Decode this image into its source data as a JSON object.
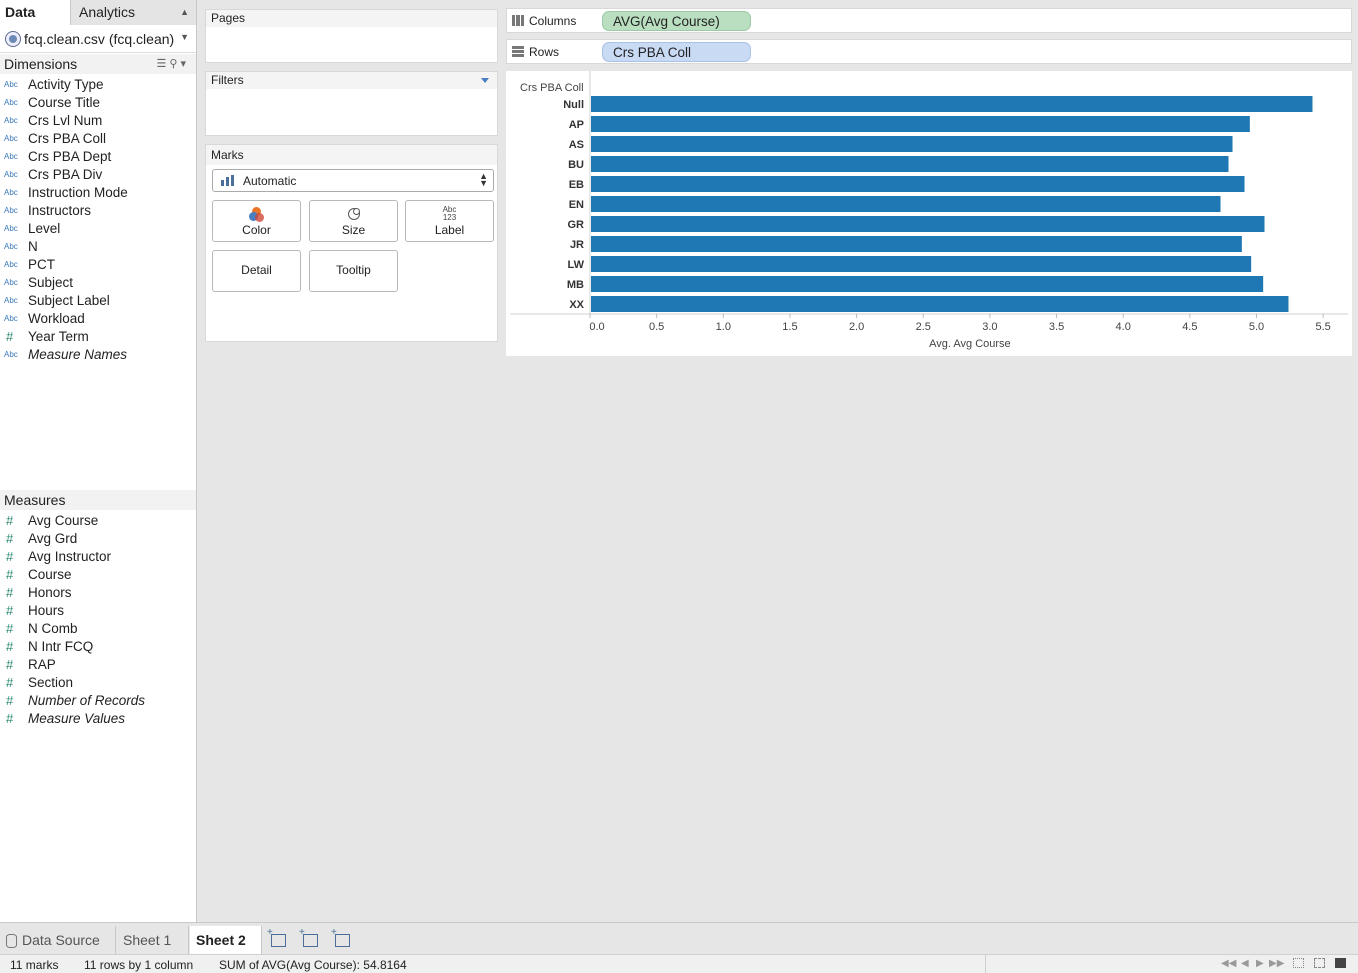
{
  "left_pane": {
    "tabs": [
      "Data",
      "Analytics"
    ],
    "datasource": "fcq.clean.csv (fcq.clean)",
    "dimensions_header": "Dimensions",
    "dimensions": [
      {
        "type": "Abc",
        "label": "Activity Type"
      },
      {
        "type": "Abc",
        "label": "Course Title"
      },
      {
        "type": "Abc",
        "label": "Crs Lvl Num"
      },
      {
        "type": "Abc",
        "label": "Crs PBA Coll"
      },
      {
        "type": "Abc",
        "label": "Crs PBA Dept"
      },
      {
        "type": "Abc",
        "label": "Crs PBA Div"
      },
      {
        "type": "Abc",
        "label": "Instruction Mode"
      },
      {
        "type": "Abc",
        "label": "Instructors"
      },
      {
        "type": "Abc",
        "label": "Level"
      },
      {
        "type": "Abc",
        "label": "N"
      },
      {
        "type": "Abc",
        "label": "PCT"
      },
      {
        "type": "Abc",
        "label": "Subject"
      },
      {
        "type": "Abc",
        "label": "Subject Label"
      },
      {
        "type": "Abc",
        "label": "Workload"
      },
      {
        "type": "#",
        "label": "Year Term"
      },
      {
        "type": "Abc",
        "label": "Measure Names"
      }
    ],
    "measures_header": "Measures",
    "measures": [
      {
        "type": "#",
        "label": "Avg Course"
      },
      {
        "type": "#",
        "label": "Avg Grd"
      },
      {
        "type": "#",
        "label": "Avg Instructor"
      },
      {
        "type": "#",
        "label": "Course"
      },
      {
        "type": "#",
        "label": "Honors"
      },
      {
        "type": "#",
        "label": "Hours"
      },
      {
        "type": "#",
        "label": "N Comb"
      },
      {
        "type": "#",
        "label": "N Intr FCQ"
      },
      {
        "type": "#",
        "label": "RAP"
      },
      {
        "type": "#",
        "label": "Section"
      },
      {
        "type": "#",
        "label": "Number of Records"
      },
      {
        "type": "#",
        "label": "Measure Values"
      }
    ]
  },
  "cards": {
    "pages": "Pages",
    "filters": "Filters",
    "marks": "Marks",
    "mark_type": "Automatic",
    "mark_buttons": {
      "color": "Color",
      "size": "Size",
      "label": "Label",
      "label_glyph_top": "Abc",
      "label_glyph_bottom": "123",
      "detail": "Detail",
      "tooltip": "Tooltip"
    }
  },
  "shelves": {
    "columns_label": "Columns",
    "columns_pill": "AVG(Avg Course)",
    "rows_label": "Rows",
    "rows_pill": "Crs PBA Coll"
  },
  "colors": {
    "bar": "#1f77b4",
    "columns_pill": "#b9dfc0",
    "rows_pill": "#c9daf4"
  },
  "chart_data": {
    "type": "bar",
    "orientation": "horizontal",
    "row_header": "Crs PBA Coll",
    "categories": [
      "Null",
      "AP",
      "AS",
      "BU",
      "EB",
      "EN",
      "GR",
      "JR",
      "LW",
      "MB",
      "XX"
    ],
    "values": [
      5.42,
      4.95,
      4.82,
      4.79,
      4.91,
      4.73,
      5.06,
      4.89,
      4.96,
      5.05,
      5.24
    ],
    "xlabel": "Avg. Avg Course",
    "xticks": [
      "0.0",
      "0.5",
      "1.0",
      "1.5",
      "2.0",
      "2.5",
      "3.0",
      "3.5",
      "4.0",
      "4.5",
      "5.0",
      "5.5"
    ],
    "xlim": [
      0,
      5.7
    ],
    "grid": false
  },
  "sheet_tabs": {
    "datasource": "Data Source",
    "sheet1": "Sheet 1",
    "sheet2": "Sheet 2"
  },
  "status_bar": {
    "marks": "11 marks",
    "rows": "11 rows by 1 column",
    "sum": "SUM of AVG(Avg Course): 54.8164"
  }
}
